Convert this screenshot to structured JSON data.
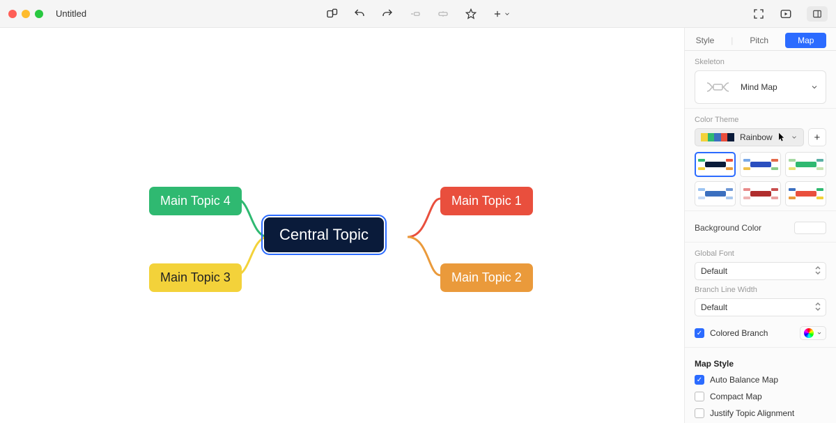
{
  "window": {
    "title": "Untitled"
  },
  "inspector": {
    "tabs": {
      "style": "Style",
      "pitch": "Pitch",
      "map": "Map"
    },
    "skeleton": {
      "label": "Skeleton",
      "value": "Mind Map"
    },
    "color_theme": {
      "label": "Color Theme",
      "value": "Rainbow"
    },
    "background": {
      "label": "Background Color"
    },
    "global_font": {
      "label": "Global Font",
      "value": "Default"
    },
    "branch_width": {
      "label": "Branch Line Width",
      "value": "Default"
    },
    "colored_branch": {
      "label": "Colored Branch"
    },
    "map_style": {
      "title": "Map Style",
      "auto_balance": "Auto Balance Map",
      "compact": "Compact Map",
      "justify": "Justify Topic Alignment"
    }
  },
  "mindmap": {
    "central": "Central Topic",
    "topic1": "Main Topic 1",
    "topic2": "Main Topic 2",
    "topic3": "Main Topic 3",
    "topic4": "Main Topic 4"
  }
}
